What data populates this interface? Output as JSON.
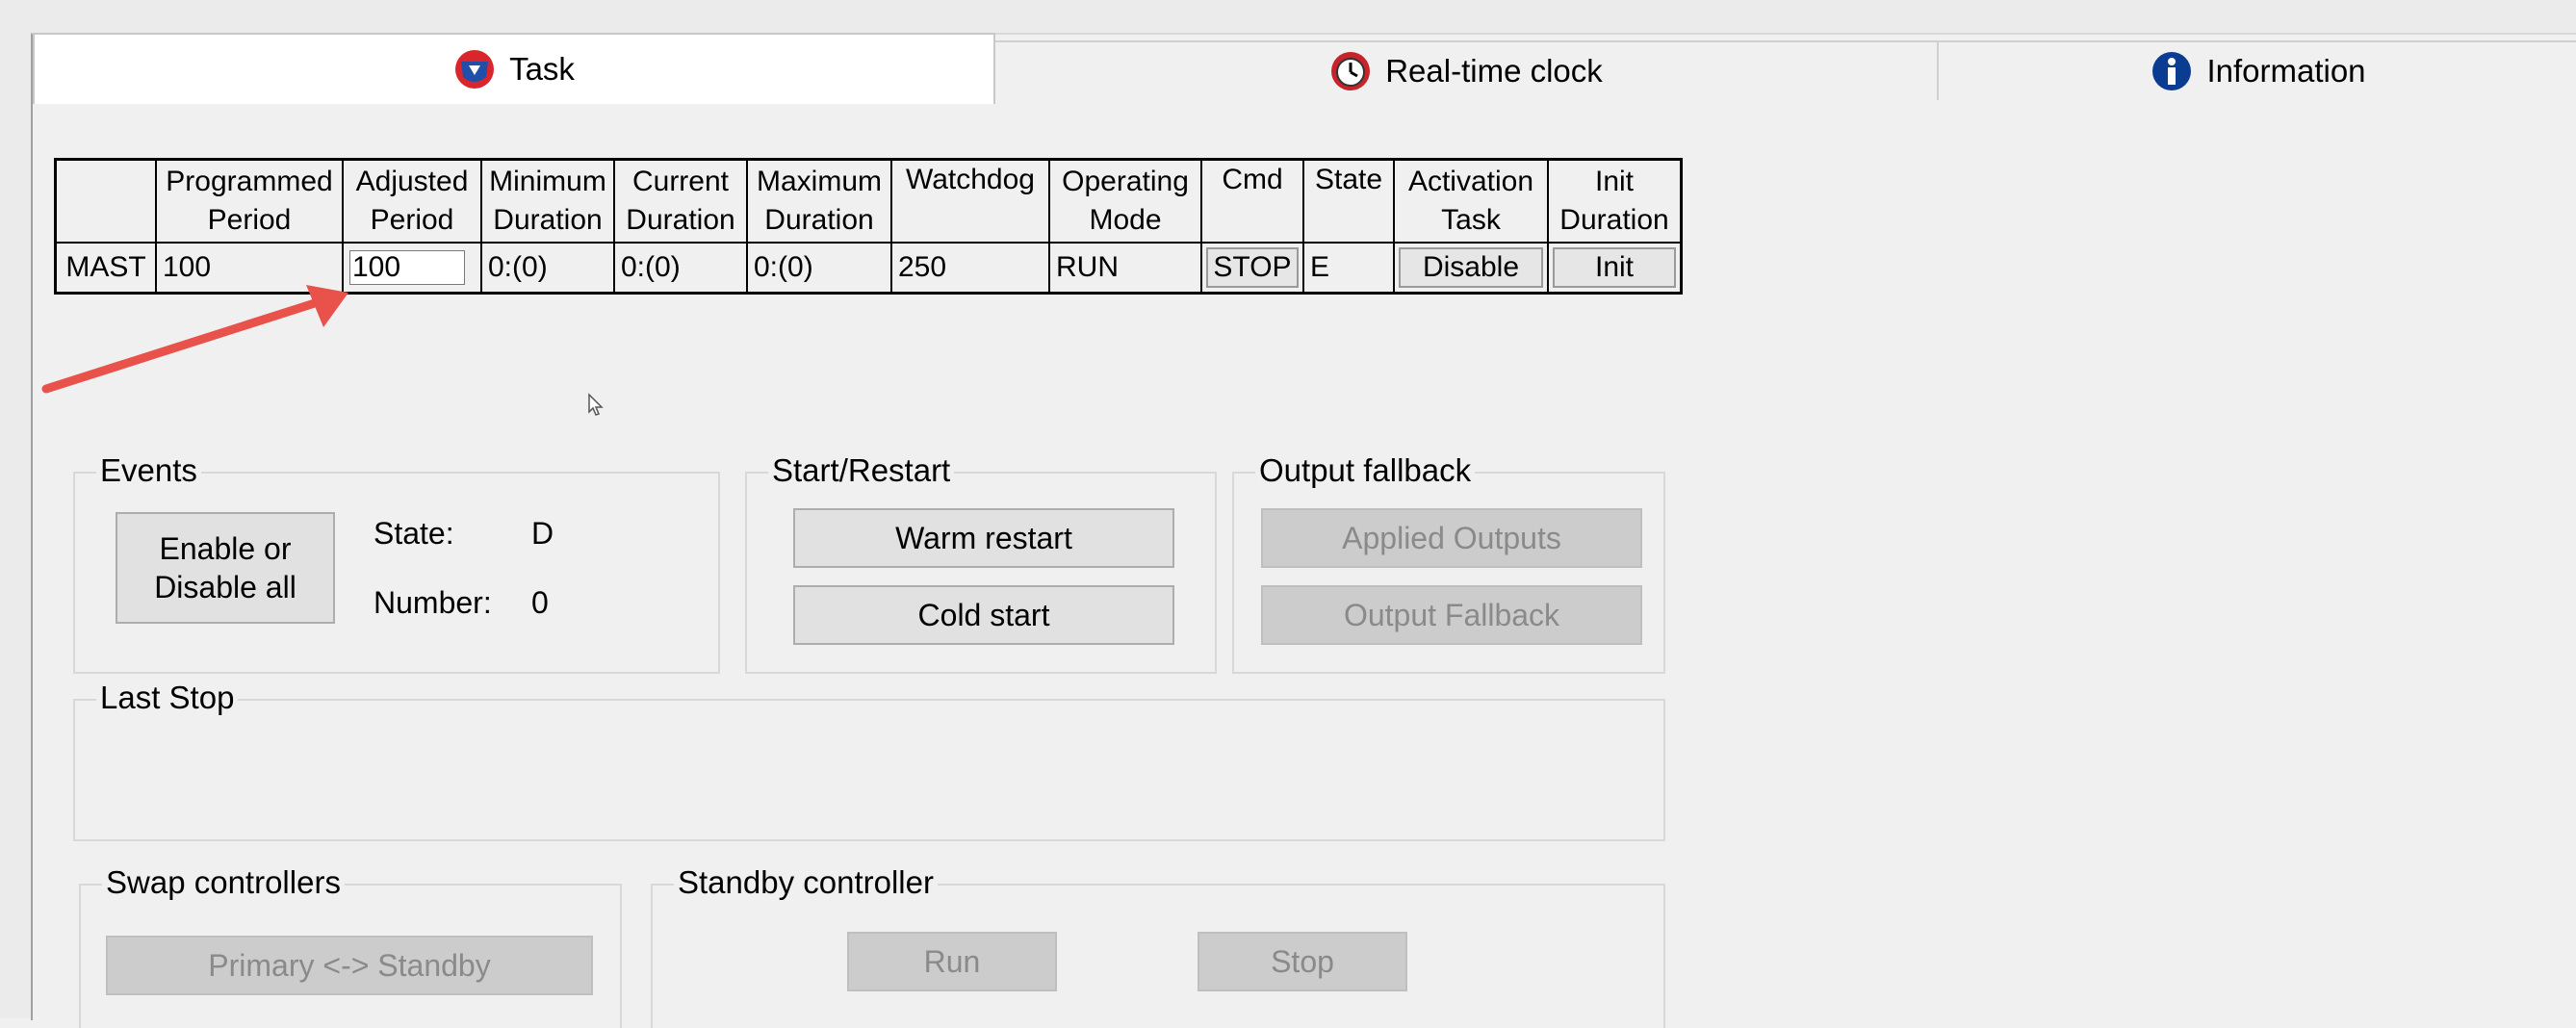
{
  "tabs": [
    {
      "label": "Task",
      "icon": "task-icon"
    },
    {
      "label": "Real-time clock",
      "icon": "clock-icon"
    },
    {
      "label": "Information",
      "icon": "info-icon"
    }
  ],
  "table": {
    "headers": [
      {
        "line1": "",
        "line2": ""
      },
      {
        "line1": "Programmed",
        "line2": "Period"
      },
      {
        "line1": "Adjusted",
        "line2": "Period"
      },
      {
        "line1": "Minimum",
        "line2": "Duration"
      },
      {
        "line1": "Current",
        "line2": "Duration"
      },
      {
        "line1": "Maximum",
        "line2": "Duration"
      },
      {
        "line1": "Watchdog",
        "line2": ""
      },
      {
        "line1": "Operating",
        "line2": "Mode"
      },
      {
        "line1": "Cmd",
        "line2": ""
      },
      {
        "line1": "State",
        "line2": ""
      },
      {
        "line1": "Activation",
        "line2": "Task"
      },
      {
        "line1": "Init",
        "line2": "Duration"
      }
    ],
    "row": {
      "name": "MAST",
      "programmed_period": "100",
      "adjusted_period": "100",
      "minimum_duration": "0:(0)",
      "current_duration": "0:(0)",
      "maximum_duration": "0:(0)",
      "watchdog": "250",
      "operating_mode": "RUN",
      "cmd": "STOP",
      "state": "E",
      "activation": "Disable",
      "init": "Init"
    }
  },
  "events": {
    "title": "Events",
    "enable_button_line1": "Enable or",
    "enable_button_line2": "Disable all",
    "state_label": "State:",
    "state_value": "D",
    "number_label": "Number:",
    "number_value": "0"
  },
  "start_restart": {
    "title": "Start/Restart",
    "warm_restart": "Warm restart",
    "cold_start": "Cold start"
  },
  "output_fallback": {
    "title": "Output fallback",
    "applied_outputs": "Applied Outputs",
    "output_fallback": "Output Fallback"
  },
  "last_stop": {
    "title": "Last Stop"
  },
  "swap_controllers": {
    "title": "Swap controllers",
    "button": "Primary <-> Standby"
  },
  "standby_controller": {
    "title": "Standby controller",
    "run": "Run",
    "stop": "Stop"
  },
  "colors": {
    "arrow": "#e8524a",
    "task_icon_red": "#d9262c",
    "task_icon_blue": "#1f4fa8",
    "clock_red": "#c8232c",
    "info_blue": "#0a3d91"
  }
}
